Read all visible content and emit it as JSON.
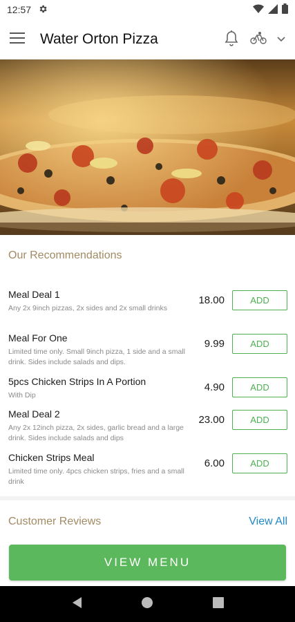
{
  "status_bar": {
    "time": "12:57"
  },
  "app_bar": {
    "title": "Water Orton Pizza"
  },
  "recommendations": {
    "title": "Our Recommendations",
    "add_label": "ADD",
    "items": [
      {
        "name": "Meal Deal 1",
        "desc": "Any 2x 9inch pizzas, 2x sides and 2x small drinks",
        "price": "18.00"
      },
      {
        "name": "Meal For One",
        "desc": "Limited time only. Small 9inch pizza, 1 side and a small drink. Sides include salads and dips.",
        "price": "9.99"
      },
      {
        "name": "5pcs Chicken Strips In A Portion",
        "desc": "With Dip",
        "price": "4.90"
      },
      {
        "name": "Meal Deal 2",
        "desc": "Any 2x 12inch pizza, 2x sides, garlic bread and a large drink. Sides include salads and dips",
        "price": "23.00"
      },
      {
        "name": "Chicken Strips Meal",
        "desc": "Limited time only. 4pcs chicken strips, fries and a small drink",
        "price": "6.00"
      }
    ]
  },
  "reviews": {
    "title": "Customer Reviews",
    "view_all": "View All"
  },
  "bottom": {
    "view_menu": "VIEW MENU"
  },
  "colors": {
    "accent_green": "#5cb85c",
    "section_gold": "#a28a62",
    "link_blue": "#1e88c8"
  }
}
